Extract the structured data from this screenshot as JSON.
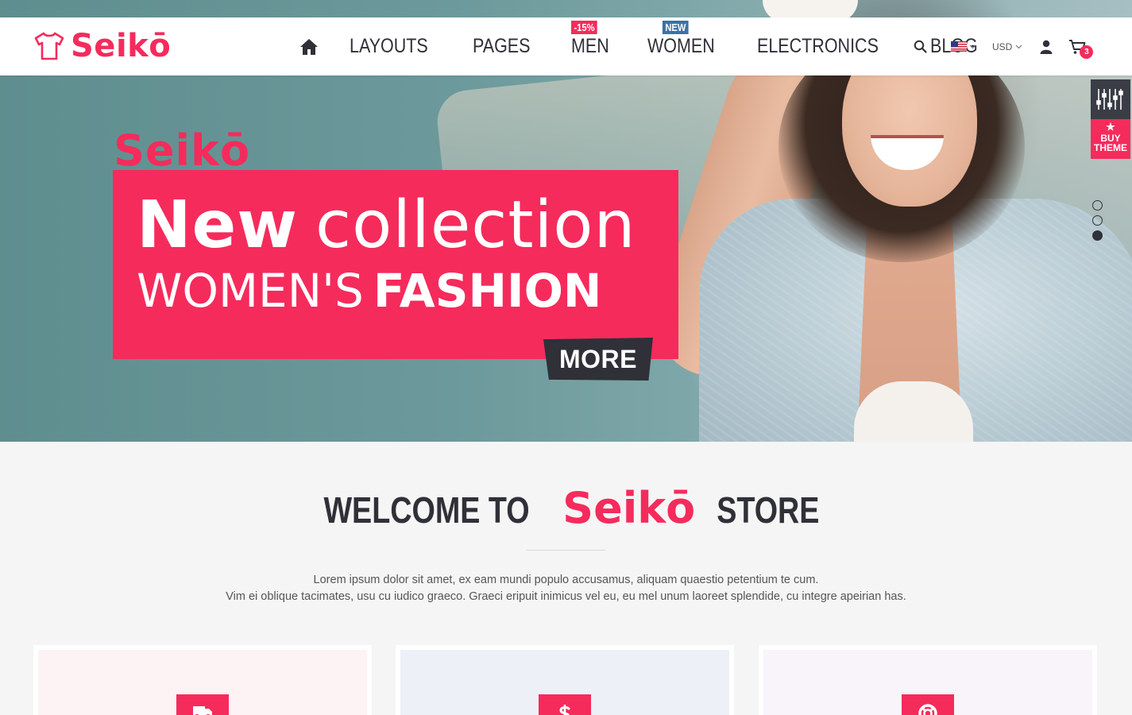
{
  "brand": {
    "name": "Seikō",
    "accent_color": "#f52b5c",
    "dark_color": "#2f3038"
  },
  "header": {
    "nav": [
      {
        "label": "LAYOUTS"
      },
      {
        "label": "PAGES"
      },
      {
        "label": "MEN",
        "badge": "-15%"
      },
      {
        "label": "WOMEN",
        "badge": "NEW"
      },
      {
        "label": "ELECTRONICS"
      },
      {
        "label": "BLOG"
      }
    ],
    "currency": "USD",
    "cart_count": "3",
    "icons": [
      "home-icon",
      "search-icon",
      "us-flag-icon",
      "user-icon",
      "cart-icon"
    ]
  },
  "hero": {
    "brand": "Seikō",
    "line1_bold": "New",
    "line1_thin": "collection",
    "line2_thin": "WOMEN'S",
    "line2_bold": "FASHION",
    "more_label": "MORE",
    "slides": 3,
    "active_slide": 3
  },
  "side_tools": {
    "buy_label_1": "BUY",
    "buy_label_2": "THEME"
  },
  "welcome": {
    "title_prefix": "WELCOME TO",
    "title_brand": "Seikō",
    "title_suffix": "STORE",
    "text_line1": "Lorem ipsum dolor sit amet, ex eam mundi populo accusamus, aliquam quaestio petentium te cum.",
    "text_line2": "Vim ei oblique tacimates, usu cu iudico graeco. Graeci eripuit inimicus vel eu, eu mel unum laoreet splendide, cu integre apeirian has."
  },
  "features": [
    {
      "icon": "delivery-truck-icon",
      "bg": "#fdf2f4"
    },
    {
      "icon": "dollar-icon",
      "bg": "#eef0f7"
    },
    {
      "icon": "lifebuoy-icon",
      "bg": "#f8f4fa"
    }
  ]
}
